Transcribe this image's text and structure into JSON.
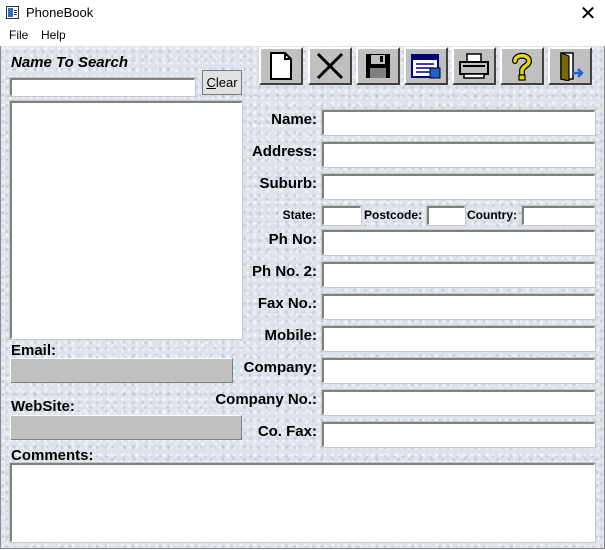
{
  "window": {
    "title": "PhoneBook",
    "close_glyph": "✕"
  },
  "menu": [
    {
      "label": "File"
    },
    {
      "label": "Help"
    }
  ],
  "search": {
    "label": "Name To Search",
    "value": "",
    "clear_first": "C",
    "clear_rest": "lear"
  },
  "toolbar": [
    {
      "name": "new-record-button",
      "icon": "new-document-icon"
    },
    {
      "name": "delete-record-button",
      "icon": "delete-x-icon"
    },
    {
      "name": "save-record-button",
      "icon": "floppy-disk-icon"
    },
    {
      "name": "view-records-button",
      "icon": "table-view-icon"
    },
    {
      "name": "print-button",
      "icon": "printer-icon"
    },
    {
      "name": "help-button",
      "icon": "question-mark-icon"
    },
    {
      "name": "exit-button",
      "icon": "exit-door-icon"
    }
  ],
  "left": {
    "email_label": "Email:",
    "website_label": "WebSite:",
    "comments_label": "Comments:"
  },
  "form": {
    "name_label": "Name:",
    "address_label": "Address:",
    "suburb_label": "Suburb:",
    "state_label": "State:",
    "postcode_label": "Postcode:",
    "country_label": "Country:",
    "phone_label": "Ph No:",
    "phone2_label": "Ph No. 2:",
    "fax_label": "Fax No.:",
    "mobile_label": "Mobile:",
    "company_label": "Company:",
    "company_no_label": "Company No.:",
    "co_fax_label": "Co. Fax:"
  },
  "colors": {
    "panel": "#dde2eb",
    "field_disabled": "#c0c0c0",
    "button_face": "#c0c0c0"
  }
}
